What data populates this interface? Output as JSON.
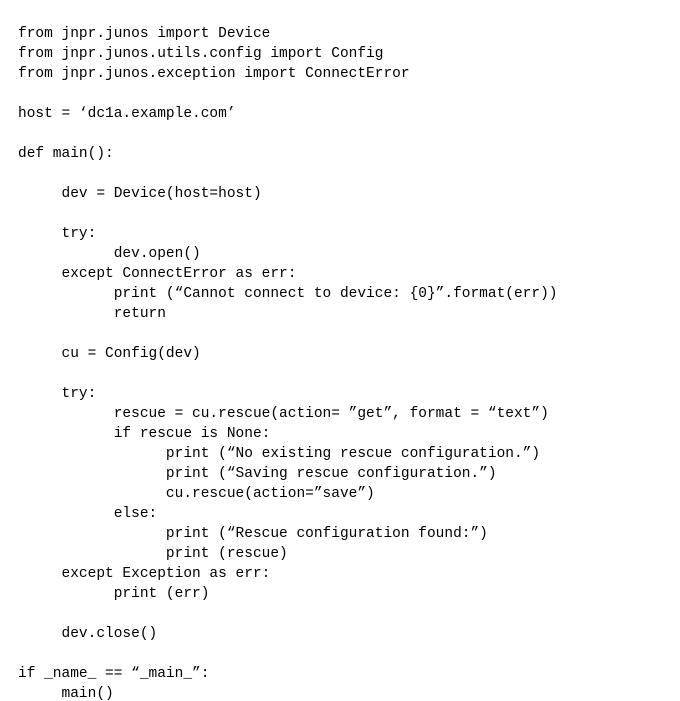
{
  "code": {
    "lines": [
      "from jnpr.junos import Device",
      "from jnpr.junos.utils.config import Config",
      "from jnpr.junos.exception import ConnectError",
      "",
      "host = ‘dc1a.example.com’",
      "",
      "def main():",
      "",
      "     dev = Device(host=host)",
      "",
      "     try:",
      "           dev.open()",
      "     except ConnectError as err:",
      "           print (“Cannot connect to device: {0}”.format(err))",
      "           return",
      "",
      "     cu = Config(dev)",
      "",
      "     try:",
      "           rescue = cu.rescue(action= ”get”, format = “text”)",
      "           if rescue is None:",
      "                 print (“No existing rescue configuration.”)",
      "                 print (“Saving rescue configuration.”)",
      "                 cu.rescue(action=”save”)",
      "           else:",
      "                 print (“Rescue configuration found:”)",
      "                 print (rescue)",
      "     except Exception as err:",
      "           print (err)",
      "",
      "     dev.close()",
      "",
      "if _name_ == “_main_”:",
      "     main()"
    ]
  }
}
